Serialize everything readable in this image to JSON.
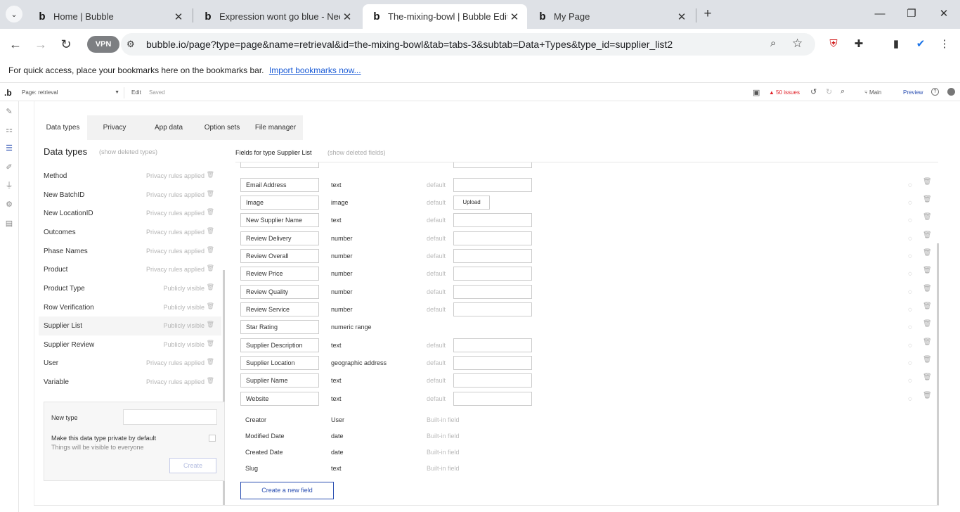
{
  "browser": {
    "tabs": [
      {
        "title": "Home | Bubble"
      },
      {
        "title": "Expression wont go blue - Need"
      },
      {
        "title": "The-mixing-bowl | Bubble Edito"
      },
      {
        "title": "My Page"
      }
    ],
    "url": "bubble.io/page?type=page&name=retrieval&id=the-mixing-bowl&tab=tabs-3&subtab=Data+Types&type_id=supplier_list2",
    "vpn_label": "VPN",
    "bookmarks_text": "For quick access, place your bookmarks here on the bookmarks bar.",
    "bookmarks_link": "Import bookmarks now..."
  },
  "editor": {
    "page_label": "Page: retrieval",
    "edit_label": "Edit",
    "saved_label": "Saved",
    "issues_label": "50 issues",
    "branch_label": "Main",
    "preview_label": "Preview",
    "tabs": [
      {
        "label": "Data types"
      },
      {
        "label": "Privacy"
      },
      {
        "label": "App data"
      },
      {
        "label": "Option sets"
      },
      {
        "label": "File manager"
      }
    ]
  },
  "data_types": {
    "title": "Data types",
    "show_deleted": "(show deleted types)",
    "items": [
      {
        "name": "Method",
        "status": "Privacy rules applied"
      },
      {
        "name": "New BatchID",
        "status": "Privacy rules applied"
      },
      {
        "name": "New LocationID",
        "status": "Privacy rules applied"
      },
      {
        "name": "Outcomes",
        "status": "Privacy rules applied"
      },
      {
        "name": "Phase Names",
        "status": "Privacy rules applied"
      },
      {
        "name": "Product",
        "status": "Privacy rules applied"
      },
      {
        "name": "Product Type",
        "status": "Publicly visible"
      },
      {
        "name": "Row Verification",
        "status": "Publicly visible"
      },
      {
        "name": "Supplier List",
        "status": "Publicly visible"
      },
      {
        "name": "Supplier Review",
        "status": "Publicly visible"
      },
      {
        "name": "User",
        "status": "Privacy rules applied"
      },
      {
        "name": "Variable",
        "status": "Privacy rules applied"
      }
    ],
    "new_type": {
      "label": "New type",
      "private_label": "Make this data type private by default",
      "private_hint": "Things will be visible to everyone",
      "create_label": "Create"
    }
  },
  "fields": {
    "title": "Fields for type Supplier List",
    "show_deleted": "(show deleted fields)",
    "default_label": "default",
    "upload_label": "Upload",
    "items": [
      {
        "name": "Email Address",
        "type": "text"
      },
      {
        "name": "Image",
        "type": "image"
      },
      {
        "name": "New Supplier Name",
        "type": "text"
      },
      {
        "name": "Review Delivery",
        "type": "number"
      },
      {
        "name": "Review Overall",
        "type": "number"
      },
      {
        "name": "Review Price",
        "type": "number"
      },
      {
        "name": "Review Quality",
        "type": "number"
      },
      {
        "name": "Review Service",
        "type": "number"
      },
      {
        "name": "Star Rating",
        "type": "numeric range"
      },
      {
        "name": "Supplier Description",
        "type": "text"
      },
      {
        "name": "Supplier Location",
        "type": "geographic address"
      },
      {
        "name": "Supplier Name",
        "type": "text"
      },
      {
        "name": "Website",
        "type": "text"
      }
    ],
    "builtin_label": "Built-in field",
    "builtin": [
      {
        "name": "Creator",
        "type": "User"
      },
      {
        "name": "Modified Date",
        "type": "date"
      },
      {
        "name": "Created Date",
        "type": "date"
      },
      {
        "name": "Slug",
        "type": "text"
      }
    ],
    "create_field_label": "Create a new field"
  }
}
